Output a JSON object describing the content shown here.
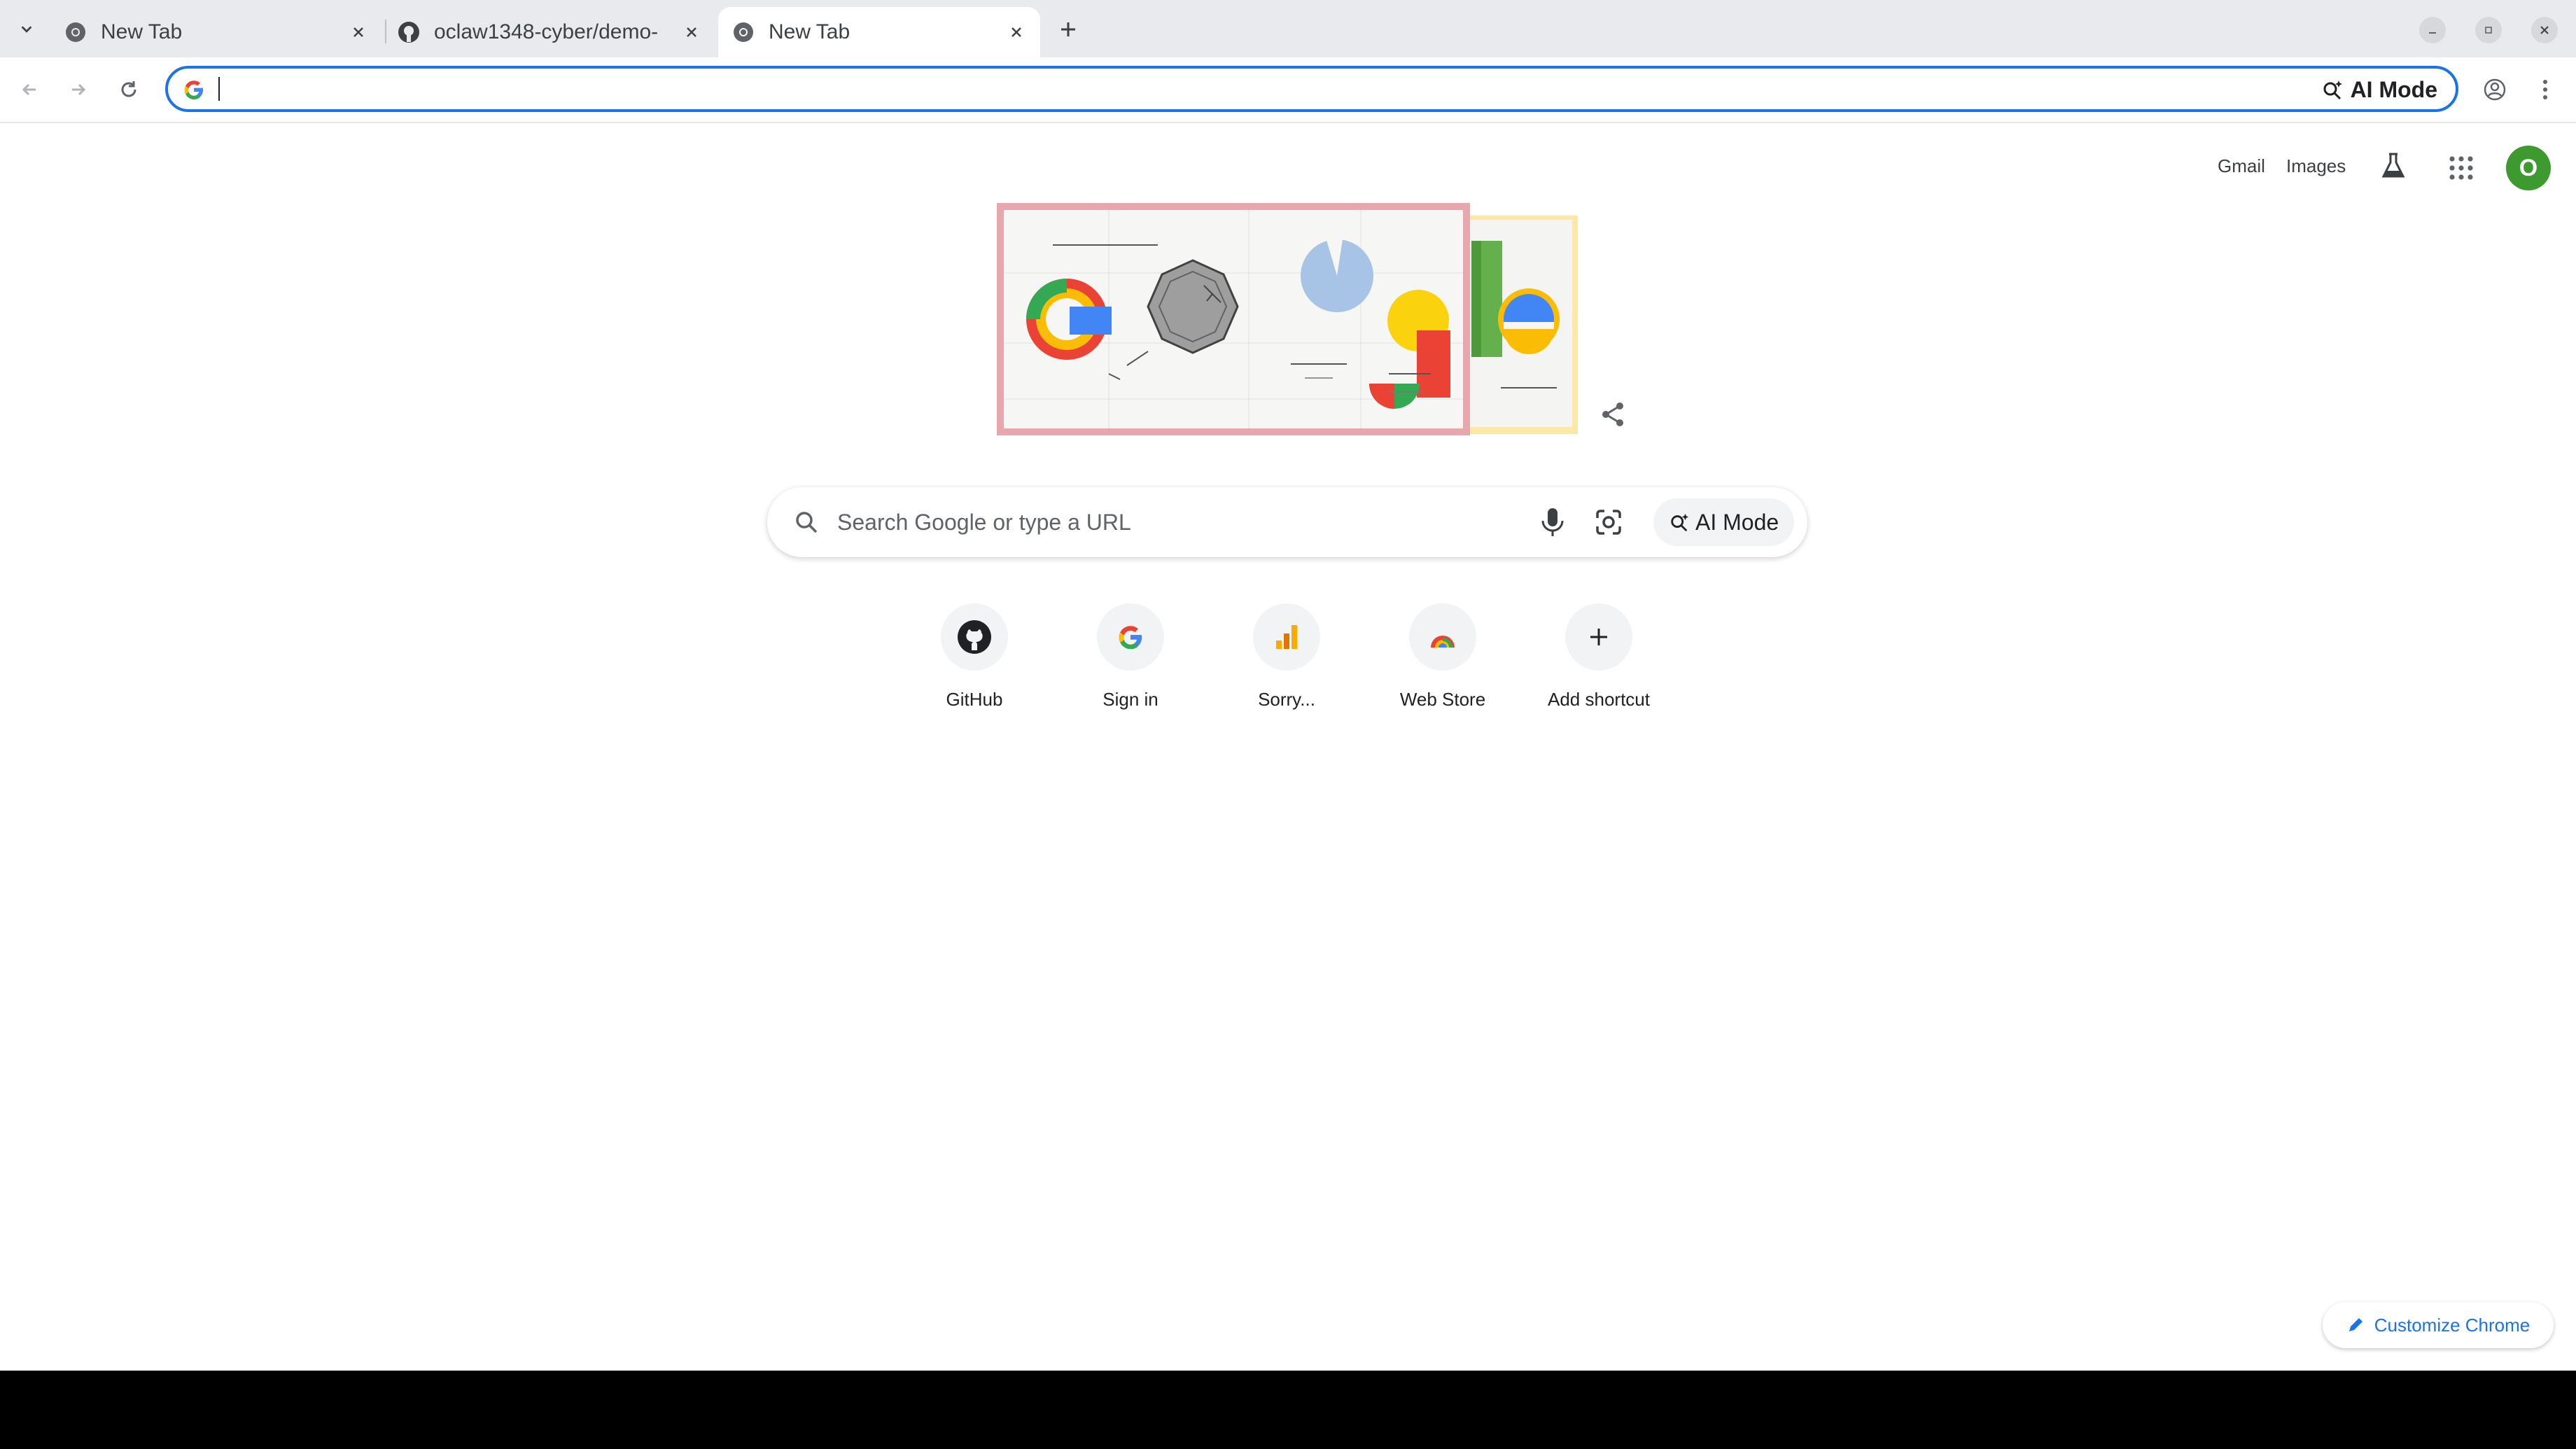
{
  "tabs": [
    {
      "title": "New Tab",
      "favicon": "chrome-icon",
      "active": false
    },
    {
      "title": "oclaw1348-cyber/demo-",
      "favicon": "github-icon",
      "active": false
    },
    {
      "title": "New Tab",
      "favicon": "chrome-icon",
      "active": true
    }
  ],
  "omnibox": {
    "value": "",
    "ai_mode_label": "AI Mode"
  },
  "header_links": {
    "gmail": "Gmail",
    "images": "Images",
    "avatar_letter": "O"
  },
  "search": {
    "placeholder": "Search Google or type a URL",
    "ai_mode_label": "AI Mode"
  },
  "shortcuts": [
    {
      "label": "GitHub",
      "icon": "github-icon"
    },
    {
      "label": "Sign in",
      "icon": "google-g-icon"
    },
    {
      "label": "Sorry...",
      "icon": "bar-chart-icon"
    },
    {
      "label": "Web Store",
      "icon": "web-store-icon"
    },
    {
      "label": "Add shortcut",
      "icon": "plus-icon"
    }
  ],
  "customize_label": "Customize Chrome",
  "colors": {
    "accent": "#1a73e8",
    "avatar": "#3d9a2f",
    "tabstrip": "#e8eaed"
  }
}
